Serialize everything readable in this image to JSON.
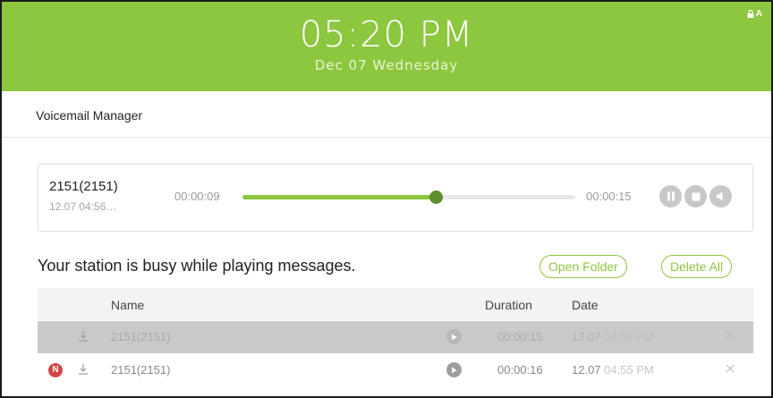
{
  "header": {
    "time": "05:20 PM",
    "date": "Dec 07 Wednesday",
    "lock_label": "A",
    "color": "#8dc63f"
  },
  "page": {
    "title": "Voicemail Manager"
  },
  "player": {
    "caller": "2151(2151)",
    "caller_time": "12.07 04:56…",
    "elapsed": "00:00:09",
    "total": "00:00:15",
    "progress": 0.58,
    "controls": [
      "pause-icon",
      "stop-icon",
      "volume-icon"
    ]
  },
  "actions": {
    "busy_message": "Your station is busy while playing messages.",
    "open_folder": "Open Folder",
    "delete_all": "Delete All"
  },
  "table": {
    "headers": {
      "name": "Name",
      "duration": "Duration",
      "date": "Date"
    },
    "rows": [
      {
        "is_new": false,
        "name": "2151(2151)",
        "duration": "00:00:15",
        "date": "12.07",
        "time": "04:56 PM",
        "playing": true
      },
      {
        "is_new": true,
        "new_badge": "N",
        "name": "2151(2151)",
        "duration": "00:00:16",
        "date": "12.07",
        "time": "04:55 PM",
        "playing": false
      }
    ]
  }
}
